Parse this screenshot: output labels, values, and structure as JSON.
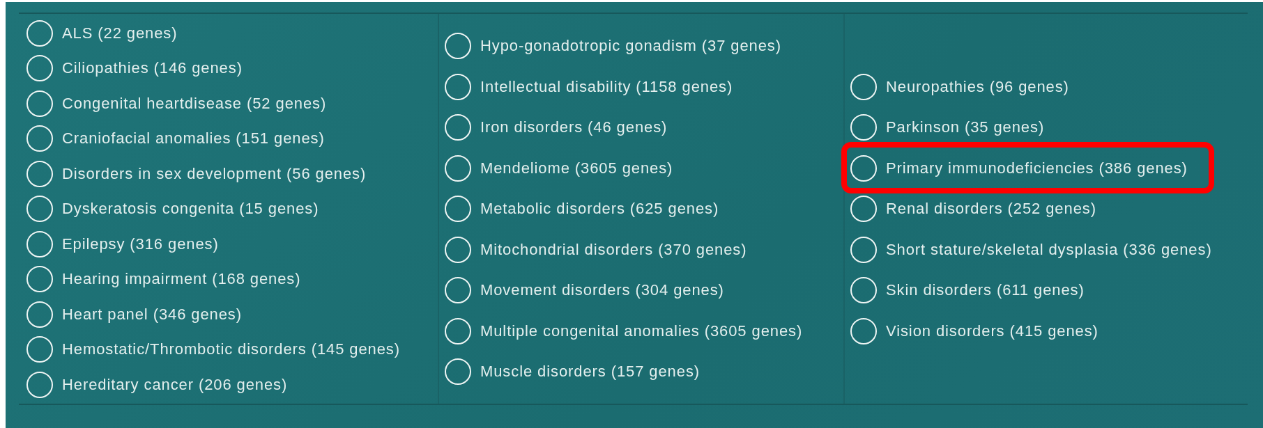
{
  "columns": [
    {
      "items": [
        {
          "label": "ALS (22 genes)",
          "selected": false,
          "highlighted": false
        },
        {
          "label": "Ciliopathies (146 genes)",
          "selected": false,
          "highlighted": false
        },
        {
          "label": "Congenital heartdisease (52 genes)",
          "selected": false,
          "highlighted": false
        },
        {
          "label": "Craniofacial anomalies (151 genes)",
          "selected": false,
          "highlighted": false
        },
        {
          "label": "Disorders in sex development (56 genes)",
          "selected": false,
          "highlighted": false
        },
        {
          "label": "Dyskeratosis congenita (15 genes)",
          "selected": false,
          "highlighted": false
        },
        {
          "label": "Epilepsy (316 genes)",
          "selected": false,
          "highlighted": false
        },
        {
          "label": "Hearing impairment (168 genes)",
          "selected": false,
          "highlighted": false
        },
        {
          "label": "Heart panel (346 genes)",
          "selected": false,
          "highlighted": false
        },
        {
          "label": "Hemostatic/Thrombotic disorders (145 genes)",
          "selected": false,
          "highlighted": false
        },
        {
          "label": "Hereditary cancer (206 genes)",
          "selected": false,
          "highlighted": false
        }
      ]
    },
    {
      "items": [
        {
          "label": "Hypo-gonadotropic gonadism (37 genes)",
          "selected": false,
          "highlighted": false
        },
        {
          "label": "Intellectual disability (1158 genes)",
          "selected": false,
          "highlighted": false
        },
        {
          "label": "Iron disorders (46 genes)",
          "selected": false,
          "highlighted": false
        },
        {
          "label": "Mendeliome (3605 genes)",
          "selected": false,
          "highlighted": false
        },
        {
          "label": "Metabolic disorders (625 genes)",
          "selected": false,
          "highlighted": false
        },
        {
          "label": "Mitochondrial disorders (370 genes)",
          "selected": false,
          "highlighted": false
        },
        {
          "label": "Movement disorders (304 genes)",
          "selected": false,
          "highlighted": false
        },
        {
          "label": "Multiple congenital anomalies (3605 genes)",
          "selected": false,
          "highlighted": false
        },
        {
          "label": "Muscle disorders (157 genes)",
          "selected": false,
          "highlighted": false
        }
      ]
    },
    {
      "items": [
        {
          "label": "Neuropathies (96 genes)",
          "selected": false,
          "highlighted": false
        },
        {
          "label": "Parkinson (35 genes)",
          "selected": false,
          "highlighted": false
        },
        {
          "label": "Primary immunodeficiencies (386 genes)",
          "selected": false,
          "highlighted": true
        },
        {
          "label": "Renal disorders (252 genes)",
          "selected": false,
          "highlighted": false
        },
        {
          "label": "Short stature/skeletal dysplasia (336 genes)",
          "selected": false,
          "highlighted": false
        },
        {
          "label": "Skin disorders (611 genes)",
          "selected": false,
          "highlighted": false
        },
        {
          "label": "Vision disorders (415 genes)",
          "selected": false,
          "highlighted": false
        }
      ]
    }
  ]
}
